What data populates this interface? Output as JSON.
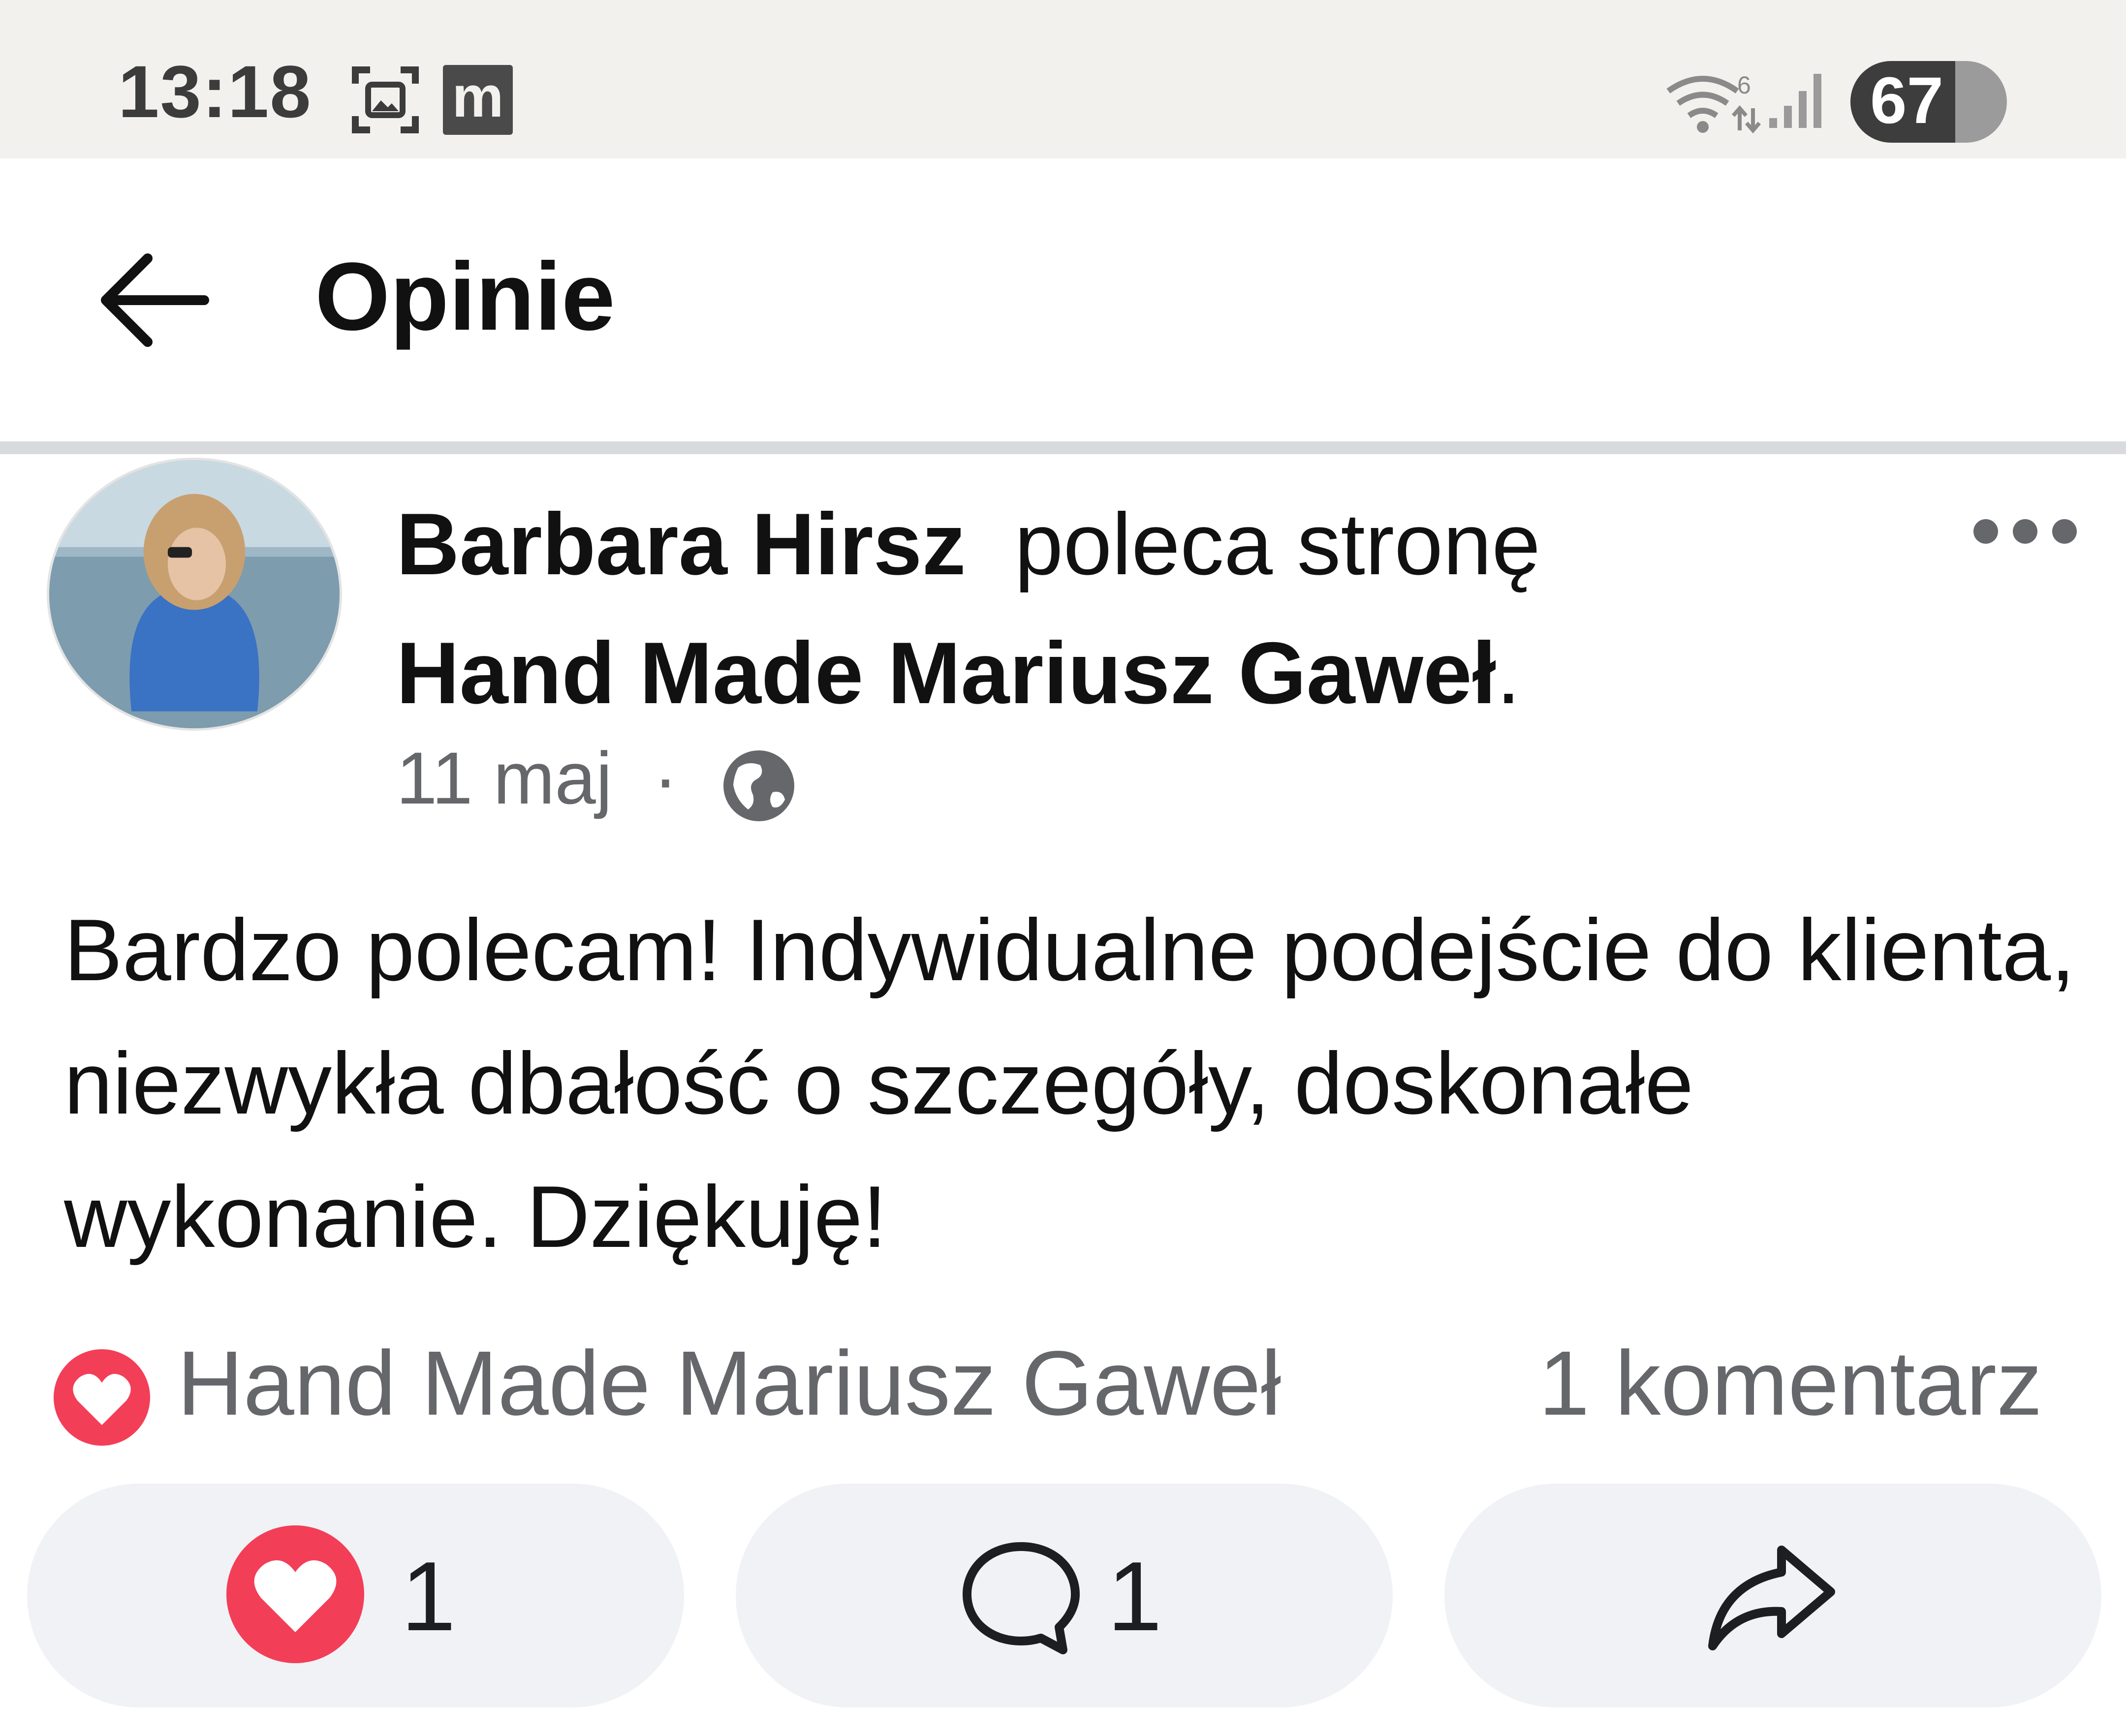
{
  "status_bar": {
    "time": "13:18",
    "m_badge": "m",
    "battery_level": "67",
    "battery_fraction": 0.67,
    "icons": [
      "screenshot-icon",
      "m-icon",
      "wifi-icon",
      "signal-icon",
      "battery-charging-icon"
    ]
  },
  "header": {
    "title": "Opinie",
    "back_icon": "arrow-left-icon"
  },
  "post": {
    "author": "Barbara Hirsz",
    "action": "poleca stronę",
    "page_name": "Hand Made Mariusz Gaweł",
    "period": ".",
    "date": "11 maj",
    "separator": "·",
    "audience_icon": "globe-icon",
    "body": "Bardzo polecam! Indywidualne podejście do klienta, niezwykła dbałość o szczegóły, doskonałe wykonanie. Dziękuję!",
    "reactions_label": "Hand Made Mariusz Gaweł",
    "comments_label": "1 komentarz"
  },
  "actions": {
    "like_count": "1",
    "comment_count": "1"
  },
  "colors": {
    "status_bar_bg": "#f3f1ee",
    "divider": "#d9dadd",
    "secondary_text": "#65676b",
    "button_bg": "#f0f2f5",
    "love_red": "#f33e58"
  }
}
